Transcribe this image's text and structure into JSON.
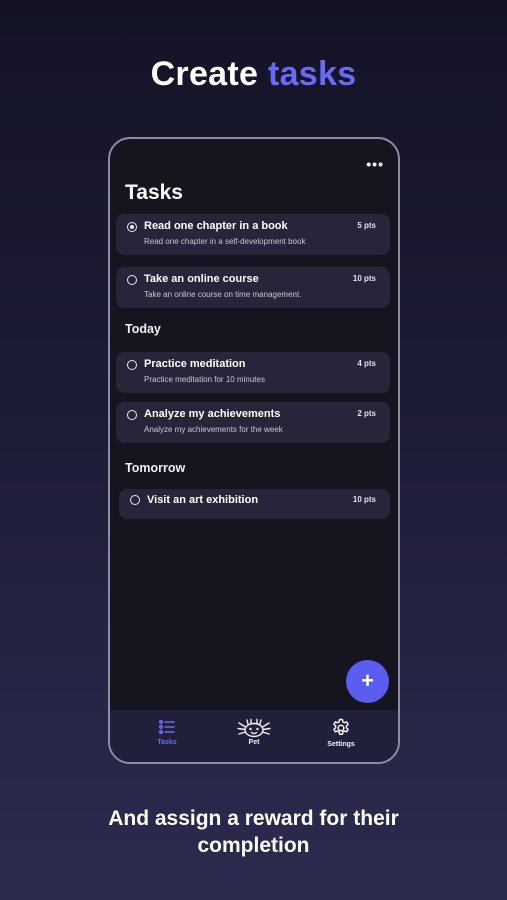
{
  "headline": {
    "prefix": "Create",
    "accent": "tasks"
  },
  "screen": {
    "title": "Tasks",
    "sections": {
      "today": "Today",
      "tomorrow": "Tomorrow"
    },
    "tasks_undated": [
      {
        "title": "Read one chapter in a book",
        "desc": "Read one chapter in a self-development book",
        "pts": "5 pts",
        "checked": true
      },
      {
        "title": "Take an online course",
        "desc": "Take an online course on time management.",
        "pts": "10 pts",
        "checked": false
      }
    ],
    "tasks_today": [
      {
        "title": "Practice meditation",
        "desc": "Practice meditation for 10 minutes",
        "pts": "4 pts",
        "checked": false
      },
      {
        "title": "Analyze my achievements",
        "desc": "Analyze my achievements for the week",
        "pts": "2 pts",
        "checked": false
      }
    ],
    "tasks_tomorrow": [
      {
        "title": "Visit an art exhibition",
        "pts": "10 pts",
        "checked": false
      }
    ],
    "fab_label": "+",
    "tabs": [
      {
        "label": "Tasks",
        "icon": "list-icon",
        "active": true
      },
      {
        "label": "Pet",
        "icon": "axolotl-pet-icon",
        "active": false
      },
      {
        "label": "Settings",
        "icon": "gear-icon",
        "active": false
      }
    ]
  },
  "caption": {
    "line1": "And assign a reward for their",
    "line2": "completion"
  },
  "colors": {
    "accent": "#6a6af5",
    "fab": "#5a5df0",
    "card": "#26253a",
    "phone_bg": "#15141f"
  }
}
